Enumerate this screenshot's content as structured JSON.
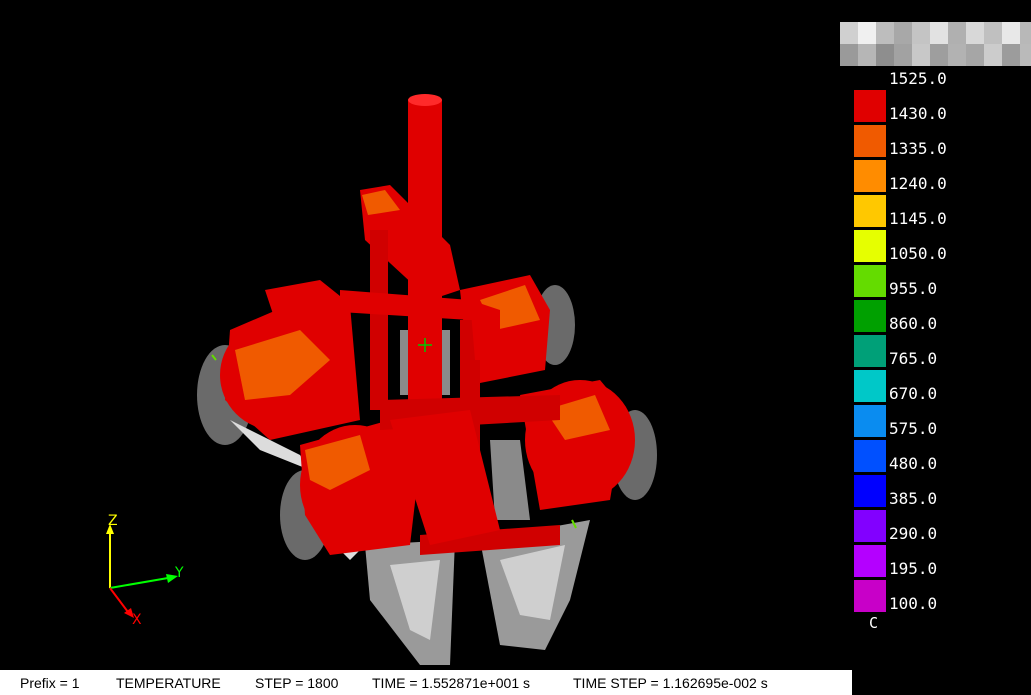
{
  "legend": {
    "unit": "C",
    "top_value": "1525.0",
    "bands": [
      {
        "value": "1430.0",
        "color": "#e00000"
      },
      {
        "value": "1335.0",
        "color": "#f05a00"
      },
      {
        "value": "1240.0",
        "color": "#ff8c00"
      },
      {
        "value": "1145.0",
        "color": "#ffc800"
      },
      {
        "value": "1050.0",
        "color": "#e6ff00"
      },
      {
        "value": "955.0",
        "color": "#64dc00"
      },
      {
        "value": "860.0",
        "color": "#00a000"
      },
      {
        "value": "765.0",
        "color": "#00a078"
      },
      {
        "value": "670.0",
        "color": "#00c8c8"
      },
      {
        "value": "575.0",
        "color": "#0a8cf0"
      },
      {
        "value": "480.0",
        "color": "#0050ff"
      },
      {
        "value": "385.0",
        "color": "#0000ff"
      },
      {
        "value": "290.0",
        "color": "#8200ff"
      },
      {
        "value": "195.0",
        "color": "#b400ff"
      },
      {
        "value": "100.0",
        "color": "#c800c8"
      }
    ]
  },
  "axes": {
    "z": "Z",
    "y": "Y",
    "x": "X"
  },
  "status": {
    "prefix": "Prefix = 1",
    "field": "TEMPERATURE",
    "step": "STEP = 1800",
    "time": "TIME = 1.552871e+001 s",
    "time_step": "TIME STEP = 1.162695e-002 s"
  }
}
